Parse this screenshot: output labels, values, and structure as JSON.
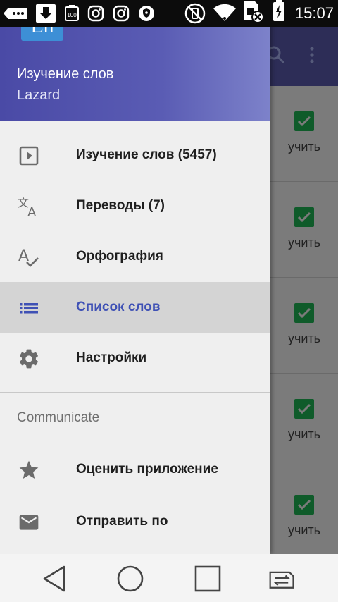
{
  "status_bar": {
    "time": "15:07",
    "battery_level_label": "100",
    "icons": [
      "more-icon",
      "download-icon",
      "battery-icon",
      "instagram-icon",
      "instagram-icon",
      "vpn-shield-icon",
      "vibrate-off-icon",
      "wifi-icon",
      "sim-missing-icon",
      "charging-icon"
    ]
  },
  "drawer": {
    "logo": "En",
    "title": "Изучение слов",
    "subtitle": "Lazard",
    "items": [
      {
        "label": "Изучение слов (5457)",
        "icon": "play-icon"
      },
      {
        "label": "Переводы (7)",
        "icon": "translate-icon"
      },
      {
        "label": "Орфография",
        "icon": "spellcheck-icon"
      },
      {
        "label": "Список слов",
        "icon": "list-icon",
        "active": true
      },
      {
        "label": "Настройки",
        "icon": "gear-icon"
      }
    ],
    "section_title": "Communicate",
    "section_items": [
      {
        "label": "Оценить приложение",
        "icon": "star-icon"
      },
      {
        "label": "Отправить по",
        "icon": "email-icon"
      }
    ]
  },
  "background_list": {
    "rows": [
      {
        "action": "учить",
        "checked": true
      },
      {
        "action": "учить",
        "checked": true
      },
      {
        "action": "учить",
        "checked": true
      },
      {
        "action": "учить",
        "checked": true
      },
      {
        "action": "учить",
        "checked": true
      }
    ]
  },
  "colors": {
    "accent": "#3f51b5",
    "header_start": "#4a4aa6",
    "header_end": "#7d82ca",
    "check_green": "#0f5b2a"
  },
  "navbar": {
    "buttons": [
      "back-icon",
      "home-icon",
      "recents-icon",
      "switch-sim-icon"
    ]
  }
}
